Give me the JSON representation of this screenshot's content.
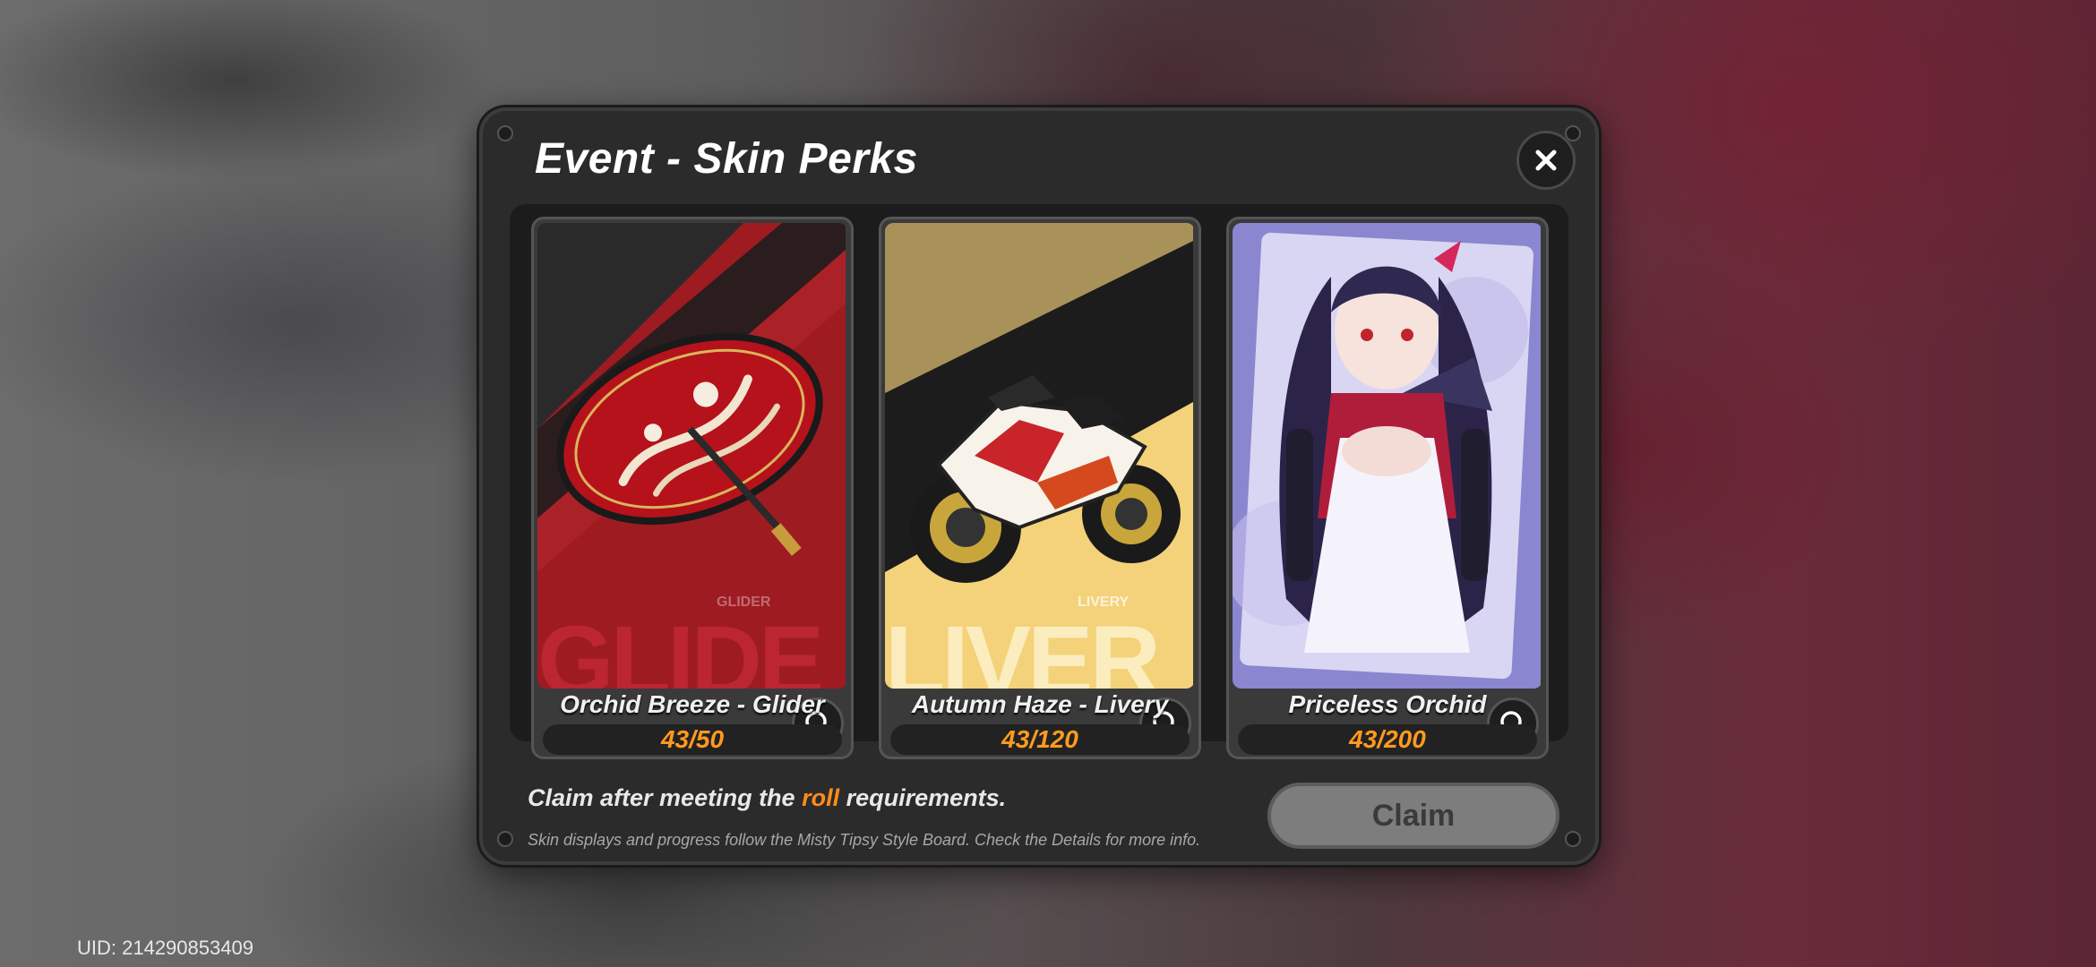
{
  "dialog": {
    "title": "Event - Skin Perks",
    "close_icon": "close-icon"
  },
  "perks": [
    {
      "name": "Orchid Breeze - Glider",
      "progress": "43/50",
      "type_tag": "GLIDER",
      "type_big": "GLIDE",
      "art_icon": "umbrella-glider",
      "accent": "#9e1b22"
    },
    {
      "name": "Autumn Haze - Livery",
      "progress": "43/120",
      "type_tag": "LIVERY",
      "type_big": "LIVER",
      "art_icon": "motorcycle-livery",
      "accent": "#f3d27a"
    },
    {
      "name": "Priceless Orchid",
      "progress": "43/200",
      "art_icon": "character-portrait",
      "accent": "#b9b3e6"
    }
  ],
  "footer": {
    "hint_prefix": "Claim after meeting the ",
    "hint_highlight": "roll",
    "hint_suffix": " requirements.",
    "subnote": "Skin displays and progress follow the Misty Tipsy Style Board. Check the Details for more info.",
    "claim_label": "Claim"
  },
  "uid": "UID: 214290853409",
  "colors": {
    "progress_text": "#ff9a1f",
    "highlight": "#ff8c1a",
    "dialog_bg": "#2b2b2b"
  }
}
